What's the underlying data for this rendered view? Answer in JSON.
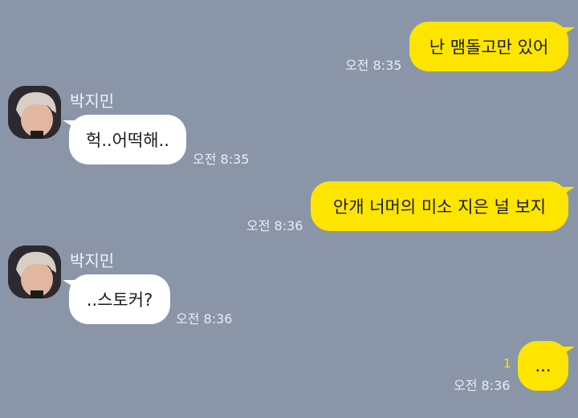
{
  "colors": {
    "background": "#8a96a8",
    "my_bubble": "#fee500",
    "their_bubble": "#ffffff",
    "unread_count": "#fee500"
  },
  "messages": [
    {
      "sender": "me",
      "text": "난 맴돌고만 있어",
      "time": "오전 8:35"
    },
    {
      "sender": "박지민",
      "text": "헉..어떡해..",
      "time": "오전 8:35",
      "avatar_icon": "profile-photo"
    },
    {
      "sender": "me",
      "text": "안개 너머의 미소 지은 널 보지",
      "time": "오전 8:36"
    },
    {
      "sender": "박지민",
      "text": "..스토커?",
      "time": "오전 8:36",
      "avatar_icon": "profile-photo"
    },
    {
      "sender": "me",
      "text": "...",
      "time": "오전 8:36",
      "unread": "1"
    }
  ]
}
